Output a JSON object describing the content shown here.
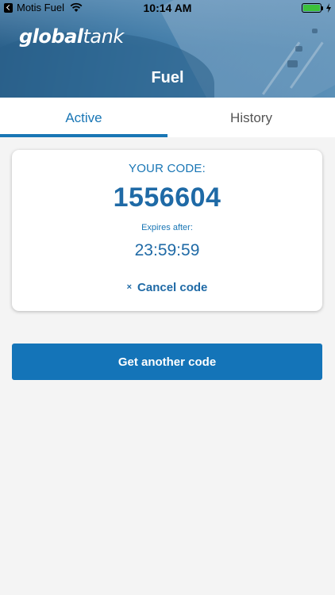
{
  "status_bar": {
    "carrier": "Motis Fuel",
    "time": "10:14 AM",
    "battery_level": 1.0
  },
  "header": {
    "logo_bold": "global",
    "logo_light": "tank",
    "title": "Fuel"
  },
  "tabs": [
    {
      "label": "Active",
      "active": true
    },
    {
      "label": "History",
      "active": false
    }
  ],
  "code_card": {
    "label": "YOUR CODE:",
    "code": "1556604",
    "expires_label": "Expires after:",
    "expires_value": "23:59:59",
    "cancel_label": "Cancel code",
    "cancel_icon": "×"
  },
  "primary_button": {
    "label": "Get another code"
  },
  "colors": {
    "accent": "#1976b5",
    "button": "#1474b8",
    "background": "#f4f4f4"
  }
}
